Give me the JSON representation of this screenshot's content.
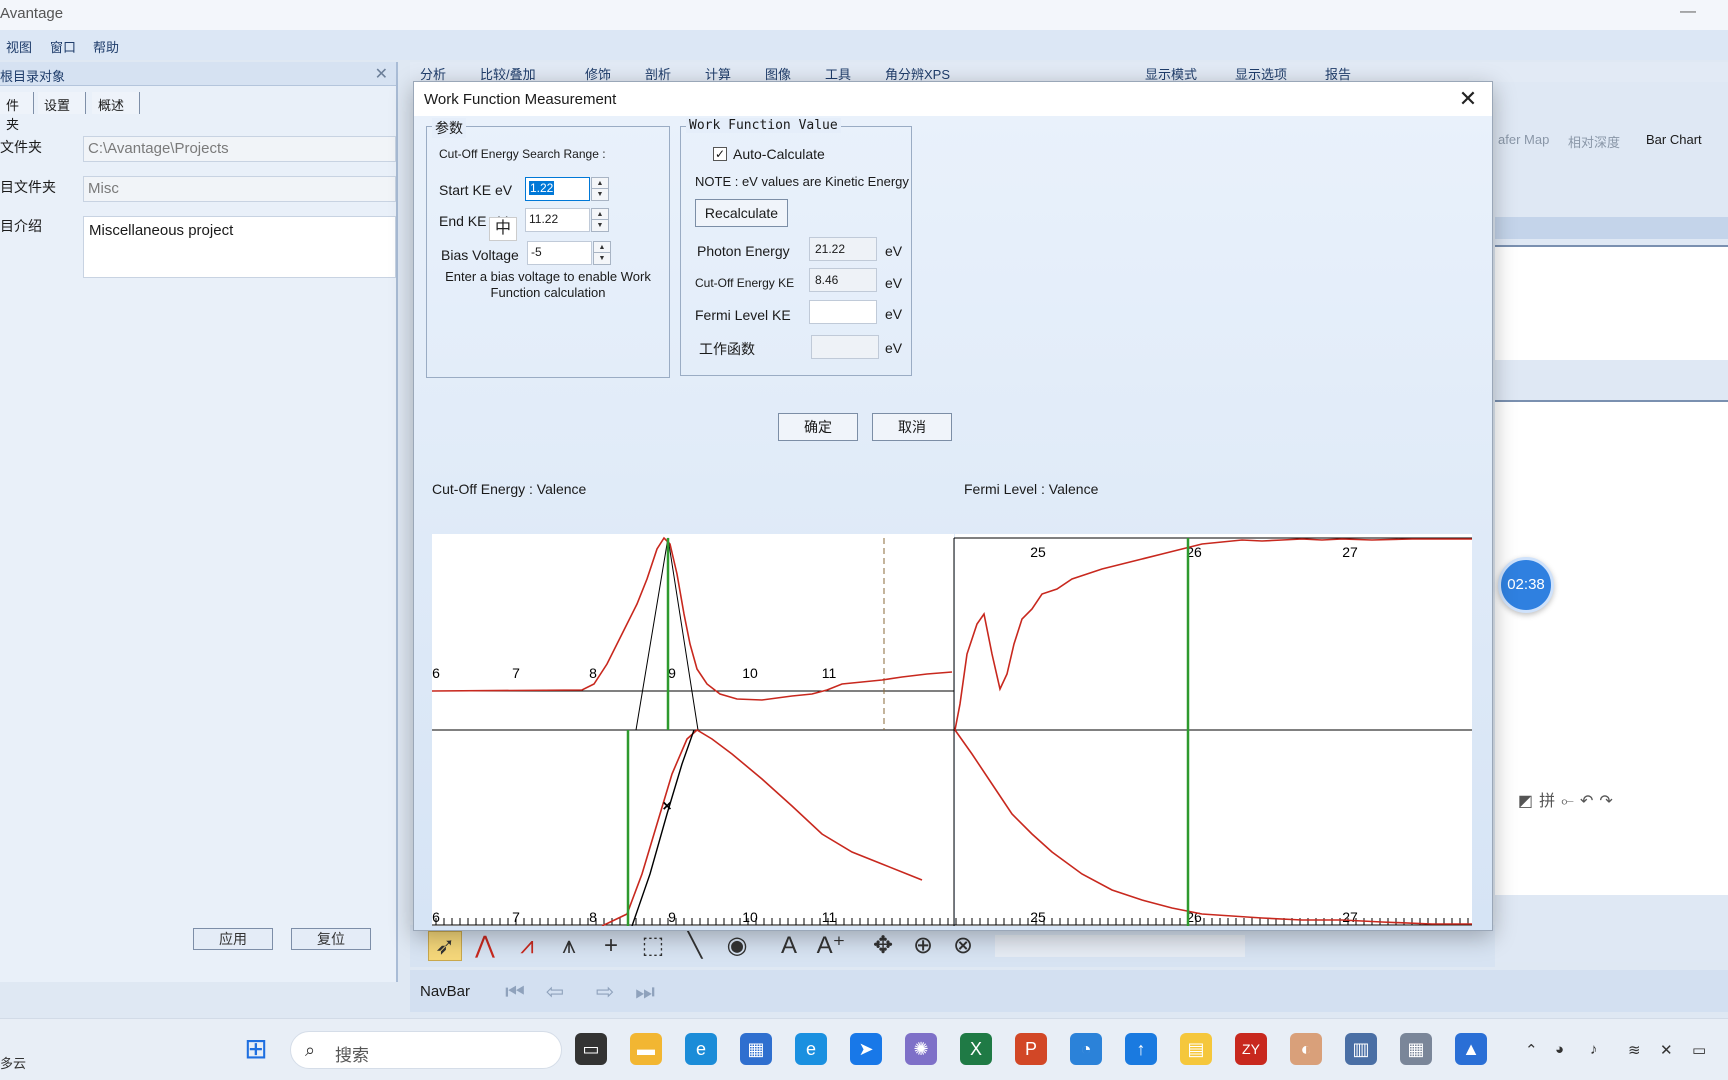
{
  "app": {
    "title": "Avantage",
    "minimize": "—"
  },
  "menu": [
    "视图",
    "窗口",
    "帮助"
  ],
  "left_panel": {
    "title": "根目录对象",
    "close": "✕",
    "tabs": [
      "件夹",
      "设置",
      "概述"
    ],
    "fields": [
      {
        "label": "文件夹",
        "value": "C:\\Avantage\\Projects"
      },
      {
        "label": "目文件夹",
        "value": "Misc"
      },
      {
        "label": "目介绍",
        "value": "Miscellaneous project"
      }
    ],
    "buttons": [
      "应用",
      "复位"
    ]
  },
  "toolbar_tabs": [
    "分析",
    "比较/叠加",
    "修饰",
    "剖析",
    "计算",
    "图像",
    "工具",
    "角分辨XPS",
    "显示模式",
    "显示选项",
    "报告"
  ],
  "view_tabs": [
    "afer Map",
    "相对深度",
    "Bar Chart"
  ],
  "timer": "02:38",
  "dialog": {
    "title": "Work Function Measurement",
    "close": "✕",
    "params": {
      "legend": "参数",
      "range_label": "Cut-Off Energy Search Range :",
      "start_label": "Start KE eV",
      "start_value": "1.22",
      "end_label": "End KE eV",
      "end_value": "11.22",
      "bias_label": "Bias Voltage",
      "bias_value": "-5",
      "bias_note": "Enter a bias voltage to enable Work Function calculation",
      "ime": "中"
    },
    "wf": {
      "legend": "Work Function Value",
      "auto_calc_label": "Auto-Calculate",
      "auto_calc_checked": true,
      "note": "NOTE : eV values are Kinetic Energy",
      "recalc_label": "Recalculate",
      "photon_label": "Photon Energy",
      "photon_value": "21.22",
      "cutoff_label": "Cut-Off Energy KE",
      "cutoff_value": "8.46",
      "fermi_label": "Fermi Level KE",
      "fermi_value": "",
      "wf_label": "工作函数",
      "wf_value": "",
      "unit": "eV"
    },
    "ok_label": "确定",
    "cancel_label": "取消",
    "plot_left_title": "Cut-Off Energy : Valence",
    "plot_right_title": "Fermi Level : Valence",
    "left_ticks": [
      "6",
      "7",
      "8",
      "9",
      "10",
      "11"
    ],
    "right_ticks": [
      "25",
      "26",
      "27"
    ]
  },
  "navbar": {
    "label": "NavBar"
  },
  "taskbar": {
    "left_text": "多云",
    "search_placeholder": "搜索"
  },
  "colors": {
    "curve": "#c8281e",
    "marker": "#2e9a2e",
    "accent": "#0078d7"
  }
}
